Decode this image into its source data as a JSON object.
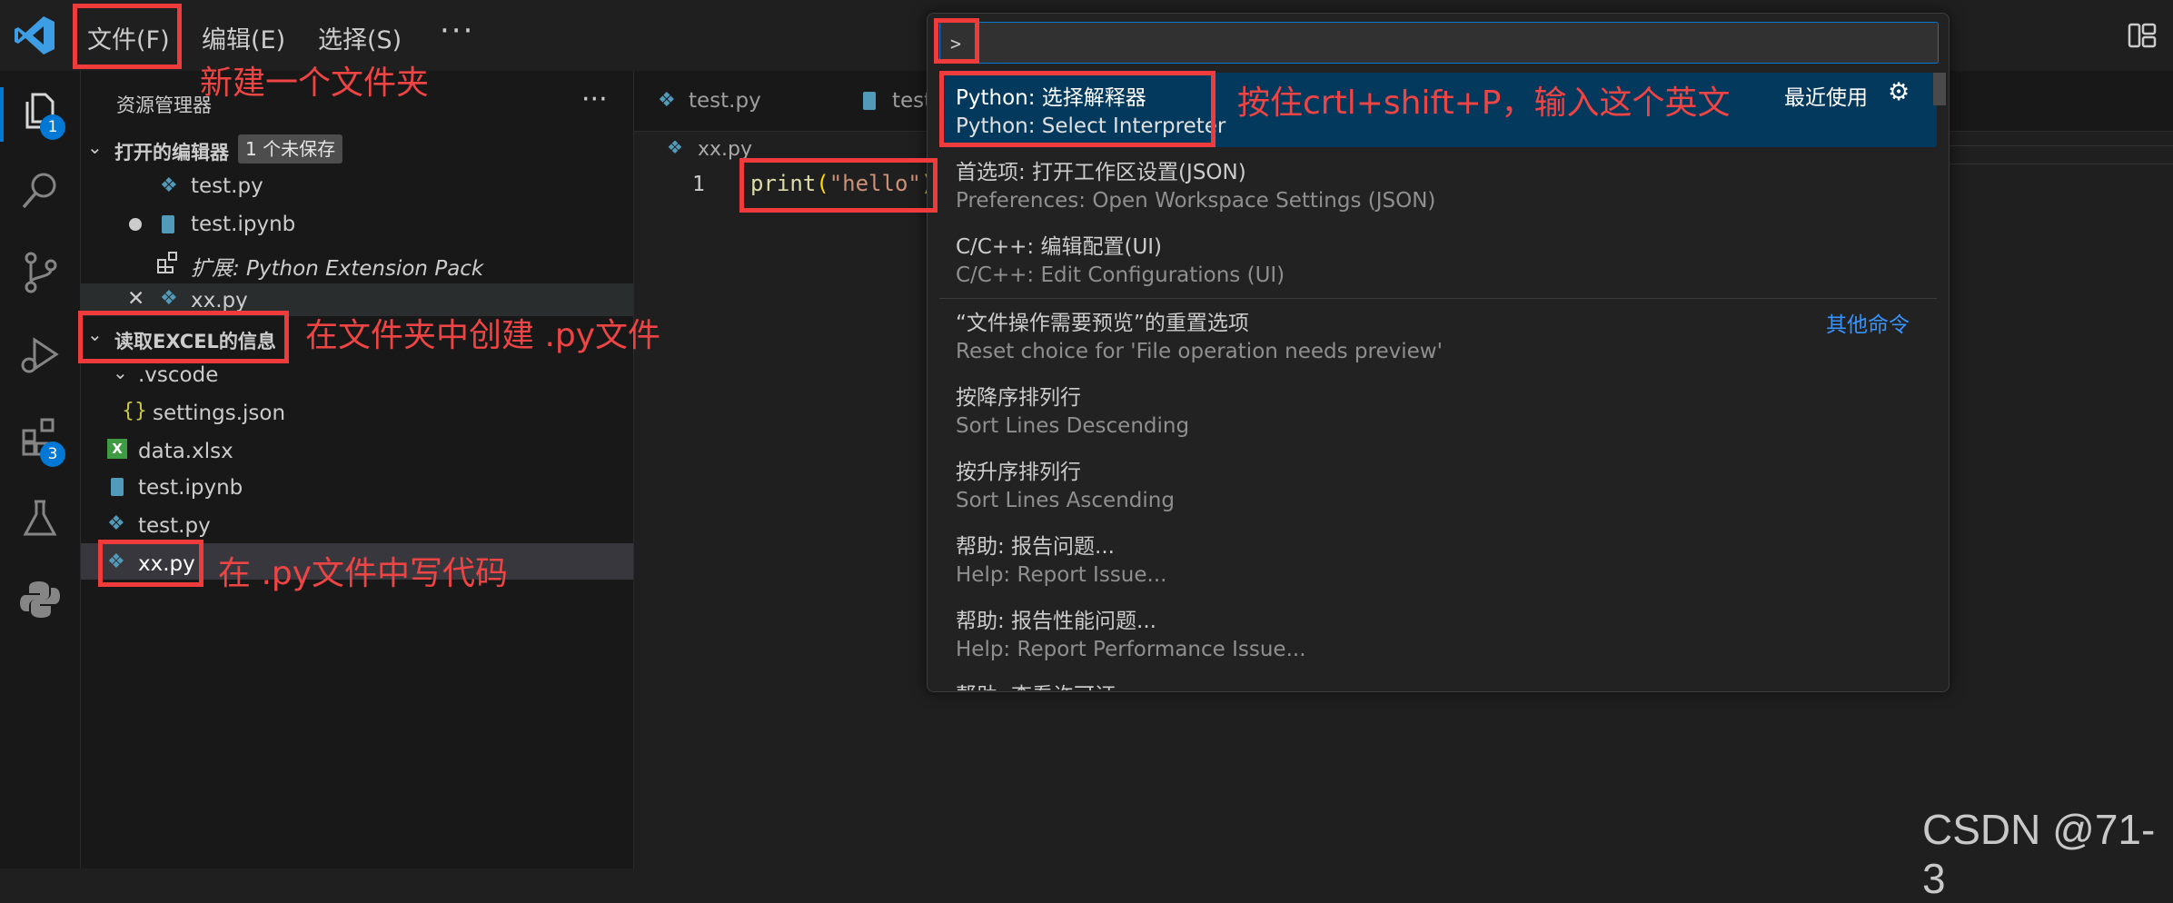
{
  "menubar": {
    "file": "文件(F)",
    "edit": "编辑(E)",
    "select": "选择(S)",
    "more": "···"
  },
  "activity": {
    "explorer_badge": "1",
    "extensions_badge": "3"
  },
  "sidebar": {
    "title": "资源管理器",
    "more": "···",
    "open_editors": {
      "title": "打开的编辑器",
      "unsaved_badge": "1 个未保存",
      "items": [
        "test.py",
        "test.ipynb",
        "扩展: Python Extension Pack",
        "xx.py"
      ]
    },
    "folder": {
      "title": "读取EXCEL的信息",
      "items": [
        ".vscode",
        "settings.json",
        "data.xlsx",
        "test.ipynb",
        "test.py",
        "xx.py"
      ]
    }
  },
  "editor": {
    "tabs": [
      "test.py",
      "test"
    ],
    "breadcrumb": "xx.py",
    "line_number": "1",
    "code": {
      "fn": "print",
      "open": "(",
      "str": "\"hello\"",
      "close": ")"
    }
  },
  "palette": {
    "prompt": ">",
    "recent_label": "最近使用",
    "other_label": "其他命令",
    "commands": [
      {
        "main": "Python: 选择解释器",
        "sub": "Python: Select Interpreter"
      },
      {
        "main": "首选项: 打开工作区设置(JSON)",
        "sub": "Preferences: Open Workspace Settings (JSON)"
      },
      {
        "main": "C/C++: 编辑配置(UI)",
        "sub": "C/C++: Edit Configurations (UI)"
      },
      {
        "main": "“文件操作需要预览”的重置选项",
        "sub": "Reset choice for 'File operation needs preview'"
      },
      {
        "main": "按降序排列行",
        "sub": "Sort Lines Descending"
      },
      {
        "main": "按升序排列行",
        "sub": "Sort Lines Ascending"
      },
      {
        "main": "帮助: 报告问题...",
        "sub": "Help: Report Issue..."
      },
      {
        "main": "帮助: 报告性能问题...",
        "sub": "Help: Report Performance Issue..."
      },
      {
        "main": "帮助: 查看许可证"
      }
    ]
  },
  "annotations": {
    "new_folder": "新建一个文件夹",
    "create_py": "在文件夹中创建 .py文件",
    "write_code": "在 .py文件中写代码",
    "shortcut": "按住crtl+shift+P，输入这个英文"
  },
  "watermark": "CSDN @71-3",
  "colors": {
    "accent": "#0078d4",
    "annotation_red": "#ef3b3b",
    "selection": "#04395e",
    "link": "#3794ff"
  }
}
